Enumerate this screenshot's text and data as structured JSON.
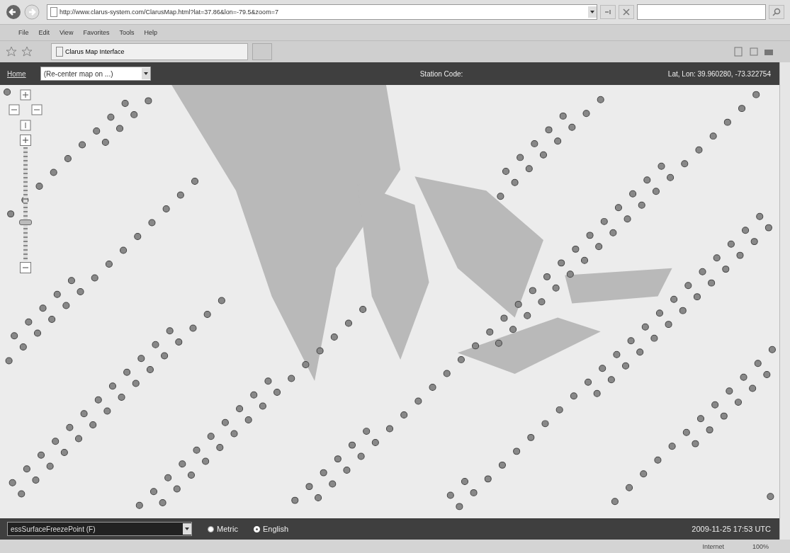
{
  "browser": {
    "address": "http://www.clarus-system.com/ClarusMap.html?lat=37.86&lon=-79.5&zoom=7",
    "menu": [
      "File",
      "Edit",
      "View",
      "Favorites",
      "Tools",
      "Help"
    ],
    "tab": {
      "title": "Clarus Map Interface"
    },
    "status": {
      "zone": "Internet",
      "zoom": "100%"
    }
  },
  "header": {
    "home_link": "Home",
    "recenter": {
      "value": "(Re-center map on ...)"
    },
    "station_code_label": "Station Code:",
    "coordinates": "Lat, Lon: 39.960280, -73.322754"
  },
  "map": {
    "zoom_slider": {
      "level": 0.31
    }
  },
  "footer": {
    "parameter": {
      "value": "essSurfaceFreezePoint (F)"
    },
    "units": [
      {
        "label": "Metric",
        "selected": false
      },
      {
        "label": "English",
        "selected": true
      }
    ],
    "timestamp": "2009-11-25 17:53 UTC"
  }
}
